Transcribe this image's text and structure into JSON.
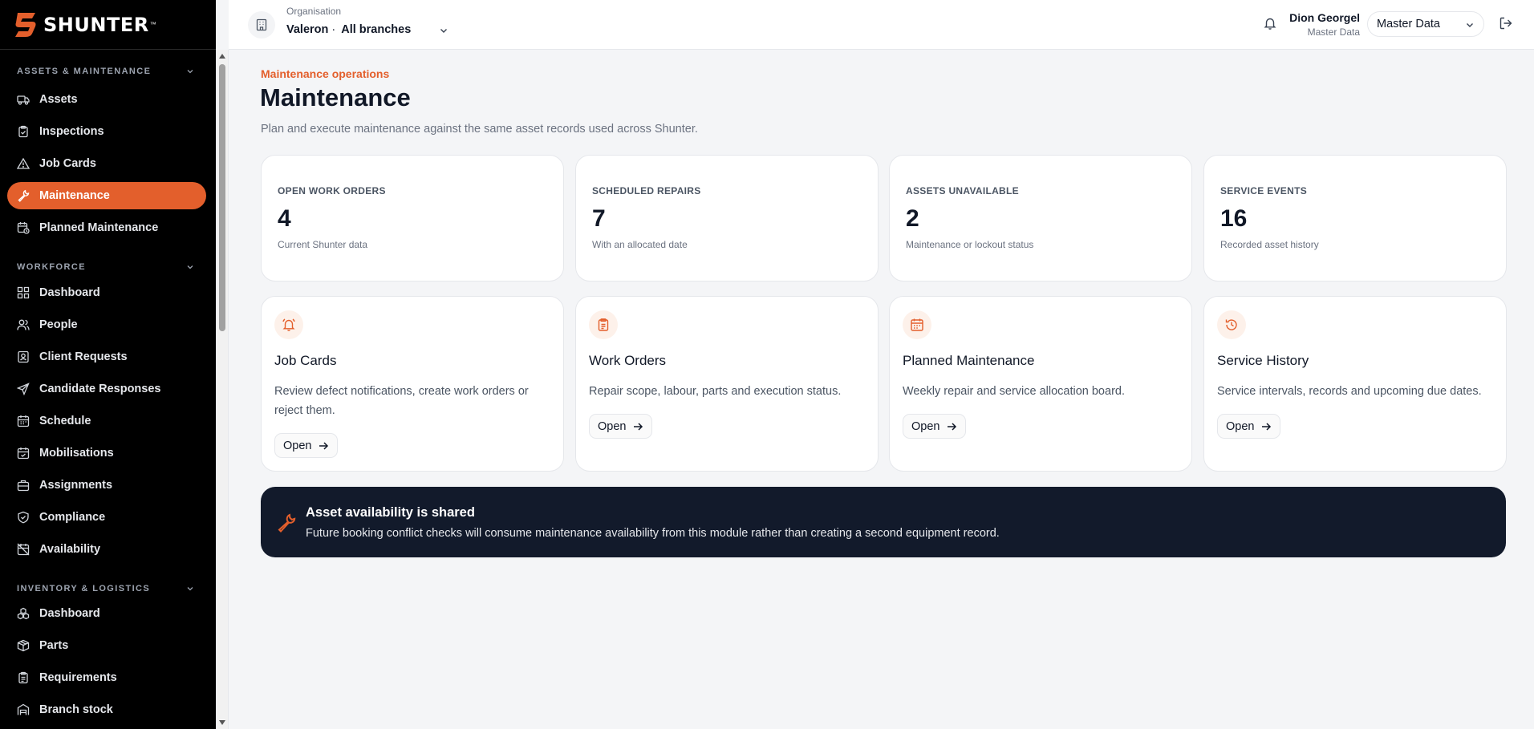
{
  "brand": {
    "name": "SHUNTER",
    "tm": "™",
    "accent": "#e35f2c"
  },
  "header": {
    "org_label": "Organisation",
    "org_name": "Valeron",
    "org_dot": "·",
    "org_branch": "All branches",
    "user_name": "Dion Georgel",
    "user_role": "Master Data",
    "role_select": "Master Data"
  },
  "sidebar": {
    "sections": [
      {
        "title": "ASSETS & MAINTENANCE",
        "items": [
          {
            "label": "Assets",
            "icon": "truck-icon"
          },
          {
            "label": "Inspections",
            "icon": "clipboard-check-icon"
          },
          {
            "label": "Job Cards",
            "icon": "warning-triangle-icon"
          },
          {
            "label": "Maintenance",
            "icon": "wrench-icon",
            "active": true
          },
          {
            "label": "Planned Maintenance",
            "icon": "calendar-clock-icon"
          }
        ]
      },
      {
        "title": "WORKFORCE",
        "items": [
          {
            "label": "Dashboard",
            "icon": "grid-icon"
          },
          {
            "label": "People",
            "icon": "users-icon"
          },
          {
            "label": "Client Requests",
            "icon": "contact-icon"
          },
          {
            "label": "Candidate Responses",
            "icon": "send-icon"
          },
          {
            "label": "Schedule",
            "icon": "calendar-icon"
          },
          {
            "label": "Mobilisations",
            "icon": "calendar-check-icon"
          },
          {
            "label": "Assignments",
            "icon": "briefcase-icon"
          },
          {
            "label": "Compliance",
            "icon": "shield-check-icon"
          },
          {
            "label": "Availability",
            "icon": "calendar-off-icon"
          }
        ]
      },
      {
        "title": "INVENTORY & LOGISTICS",
        "items": [
          {
            "label": "Dashboard",
            "icon": "boxes-icon"
          },
          {
            "label": "Parts",
            "icon": "package-icon"
          },
          {
            "label": "Requirements",
            "icon": "clipboard-list-icon"
          },
          {
            "label": "Branch stock",
            "icon": "warehouse-icon"
          }
        ]
      }
    ]
  },
  "main": {
    "eyebrow": "Maintenance operations",
    "title": "Maintenance",
    "subtitle": "Plan and execute maintenance against the same asset records used across Shunter.",
    "stats": [
      {
        "label": "OPEN WORK ORDERS",
        "value": "4",
        "note": "Current Shunter data"
      },
      {
        "label": "SCHEDULED REPAIRS",
        "value": "7",
        "note": "With an allocated date"
      },
      {
        "label": "ASSETS UNAVAILABLE",
        "value": "2",
        "note": "Maintenance or lockout status"
      },
      {
        "label": "SERVICE EVENTS",
        "value": "16",
        "note": "Recorded asset history"
      }
    ],
    "modules": [
      {
        "title": "Job Cards",
        "desc": "Review defect notifications, create work orders or reject them.",
        "button": "Open",
        "icon": "bell-ring-icon"
      },
      {
        "title": "Work Orders",
        "desc": "Repair scope, labour, parts and execution status.",
        "button": "Open",
        "icon": "clipboard-icon"
      },
      {
        "title": "Planned Maintenance",
        "desc": "Weekly repair and service allocation board.",
        "button": "Open",
        "icon": "calendar-icon"
      },
      {
        "title": "Service History",
        "desc": "Service intervals, records and upcoming due dates.",
        "button": "Open",
        "icon": "history-icon"
      }
    ],
    "banner": {
      "title": "Asset availability is shared",
      "text": "Future booking conflict checks will consume maintenance availability from this module rather than creating a second equipment record.",
      "icon": "wrench-icon"
    }
  }
}
